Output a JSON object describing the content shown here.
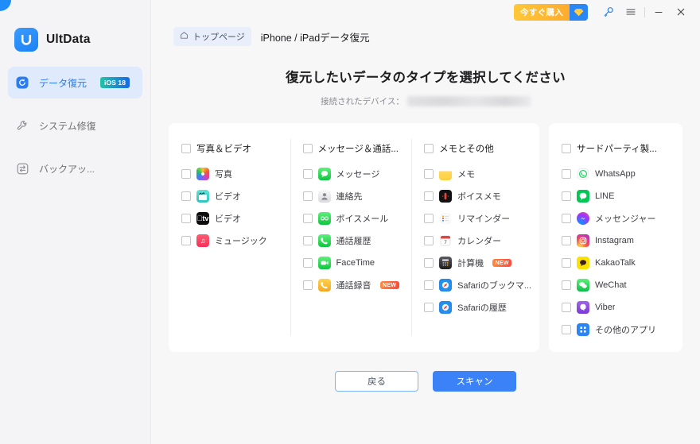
{
  "window": {
    "titlebar": {
      "buy_label": "今すぐ購入",
      "gem_icon": "gem-icon",
      "key_icon": "key-icon",
      "menu_icon": "hamburger-menu-icon",
      "minimize_icon": "minimize-icon",
      "close_icon": "close-icon"
    }
  },
  "sidebar": {
    "brand": "UltData",
    "brand_logo": "ultdata-logo-icon",
    "items": [
      {
        "label": "データ復元",
        "icon": "restore-icon",
        "badge": "iOS 18",
        "active": true
      },
      {
        "label": "システム修復",
        "icon": "wrench-icon",
        "badge": "",
        "active": false
      },
      {
        "label": "バックアッ...",
        "icon": "transfer-icon",
        "badge": "",
        "active": false
      }
    ]
  },
  "breadcrumb": {
    "home_icon": "home-icon",
    "home_label": "トップページ",
    "current": "iPhone / iPadデータ復元"
  },
  "main": {
    "page_title": "復元したいデータのタイプを選択してください",
    "device_label": "接続されたデバイス：",
    "device_value": ""
  },
  "columns": [
    {
      "header": {
        "label": "写真＆ビデオ",
        "checked": false
      },
      "items": [
        {
          "label": "写真",
          "icon": "photos-app-icon",
          "icon_class": "ic-photos",
          "glyph": "",
          "badge": "",
          "checked": false
        },
        {
          "label": "ビデオ",
          "icon": "videos-app-icon",
          "icon_class": "ic-video",
          "glyph": "🎬",
          "badge": "",
          "checked": false
        },
        {
          "label": "ビデオ",
          "icon": "apple-tv-app-icon",
          "icon_class": "ic-appletv",
          "glyph": "tv",
          "badge": "",
          "checked": false
        },
        {
          "label": "ミュージック",
          "icon": "music-app-icon",
          "icon_class": "ic-music",
          "glyph": "♫",
          "badge": "",
          "checked": false
        }
      ]
    },
    {
      "header": {
        "label": "メッセージ＆通話...",
        "checked": false
      },
      "items": [
        {
          "label": "メッセージ",
          "icon": "messages-app-icon",
          "icon_class": "ic-messages",
          "glyph": "💬",
          "badge": "",
          "checked": false
        },
        {
          "label": "連絡先",
          "icon": "contacts-app-icon",
          "icon_class": "ic-contacts",
          "glyph": "👤",
          "badge": "",
          "checked": false
        },
        {
          "label": "ボイスメール",
          "icon": "voicemail-app-icon",
          "icon_class": "ic-voicemail",
          "glyph": "oo",
          "badge": "",
          "checked": false
        },
        {
          "label": "通話履歴",
          "icon": "phone-app-icon",
          "icon_class": "ic-phone",
          "glyph": "📞",
          "badge": "",
          "checked": false
        },
        {
          "label": "FaceTime",
          "icon": "facetime-app-icon",
          "icon_class": "ic-facetime",
          "glyph": "📹",
          "badge": "",
          "checked": false
        },
        {
          "label": "通話録音",
          "icon": "call-recording-icon",
          "icon_class": "ic-callrec",
          "glyph": "📞",
          "badge": "NEW",
          "checked": false
        }
      ]
    },
    {
      "header": {
        "label": "メモとその他",
        "checked": false
      },
      "items": [
        {
          "label": "メモ",
          "icon": "notes-app-icon",
          "icon_class": "ic-notes",
          "glyph": "",
          "badge": "",
          "checked": false
        },
        {
          "label": "ボイスメモ",
          "icon": "voice-memos-app-icon",
          "icon_class": "ic-voicememo",
          "glyph": "",
          "badge": "",
          "checked": false
        },
        {
          "label": "リマインダー",
          "icon": "reminders-app-icon",
          "icon_class": "ic-reminders",
          "glyph": "",
          "badge": "",
          "checked": false
        },
        {
          "label": "カレンダー",
          "icon": "calendar-app-icon",
          "icon_class": "ic-calendar",
          "glyph": "",
          "badge": "",
          "checked": false
        },
        {
          "label": "計算機",
          "icon": "calculator-app-icon",
          "icon_class": "ic-calc",
          "glyph": "",
          "badge": "NEW",
          "checked": false
        },
        {
          "label": "Safariのブックマ...",
          "icon": "safari-app-icon",
          "icon_class": "ic-safari",
          "glyph": "",
          "badge": "",
          "checked": false
        },
        {
          "label": "Safariの履歴",
          "icon": "safari-app-icon",
          "icon_class": "ic-safari",
          "glyph": "",
          "badge": "",
          "checked": false
        }
      ]
    },
    {
      "header": {
        "label": "サードパーティ製...",
        "checked": false
      },
      "items": [
        {
          "label": "WhatsApp",
          "icon": "whatsapp-icon",
          "icon_class": "ic-whatsapp",
          "glyph": "",
          "badge": "",
          "checked": false
        },
        {
          "label": "LINE",
          "icon": "line-icon",
          "icon_class": "ic-line",
          "glyph": "",
          "badge": "",
          "checked": false
        },
        {
          "label": "メッセンジャー",
          "icon": "messenger-icon",
          "icon_class": "ic-messenger",
          "glyph": "",
          "badge": "",
          "checked": false
        },
        {
          "label": "Instagram",
          "icon": "instagram-icon",
          "icon_class": "ic-instagram",
          "glyph": "",
          "badge": "",
          "checked": false
        },
        {
          "label": "KakaoTalk",
          "icon": "kakaotalk-icon",
          "icon_class": "ic-kakao",
          "glyph": "",
          "badge": "",
          "checked": false
        },
        {
          "label": "WeChat",
          "icon": "wechat-icon",
          "icon_class": "ic-wechat",
          "glyph": "",
          "badge": "",
          "checked": false
        },
        {
          "label": "Viber",
          "icon": "viber-icon",
          "icon_class": "ic-viber",
          "glyph": "",
          "badge": "",
          "checked": false
        },
        {
          "label": "その他のアプリ",
          "icon": "other-apps-icon",
          "icon_class": "ic-otherapps",
          "glyph": "",
          "badge": "",
          "checked": false
        }
      ]
    }
  ],
  "footer": {
    "back_label": "戻る",
    "scan_label": "スキャン"
  },
  "colors": {
    "accent": "#3b82f6",
    "active_nav_bg": "#dfeafc",
    "buy_orange": "#ffab2e",
    "new_badge": "#fb4a3b",
    "sidebar_bg": "#f4f4f6",
    "content_bg": "#f7f7f8"
  }
}
